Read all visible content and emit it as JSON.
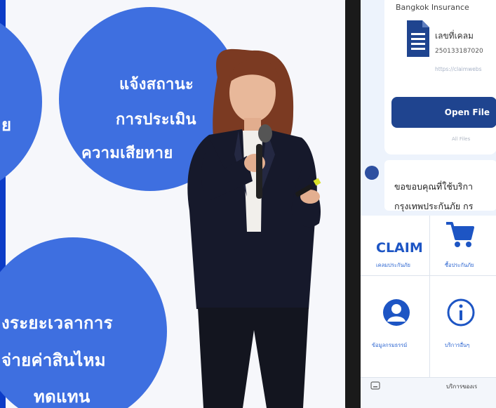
{
  "slide": {
    "circle_left_fragment": "ย",
    "circle_top": [
      "แจ้งสถานะ",
      "การประเมิน",
      "ความเสียหาย"
    ],
    "circle_bottom": [
      "งระยะเวลาการ",
      "จ่ายค่าสินไหม",
      "ทดแทน"
    ]
  },
  "phone": {
    "insurer": "Bangkok Insurance",
    "claim_label": "เลขที่เคลม",
    "claim_number": "250133187020",
    "claim_url": "https://claimwebs",
    "open_file": "Open File",
    "all_files": "All Files",
    "message_line1": "ขอขอบคุณที่ใช้บริกา",
    "message_line2": "กรุงเทพประกันภัย กร",
    "tiles": {
      "claim_title": "CLAIM",
      "claim_sub": "เคลมประกันภัย",
      "buy_sub": "ซื้อประกันภัย",
      "profile_sub": "ข้อมูลกรมธรรม์",
      "other_sub": "บริการอื่นๆ"
    },
    "bottom_text": "บริการของเร"
  },
  "colors": {
    "slide_blue": "#3e6fe0",
    "edge_blue": "#0c3cc7",
    "button_navy": "#1f448f",
    "tile_blue": "#1d55c4",
    "jacket": "#16192b"
  }
}
